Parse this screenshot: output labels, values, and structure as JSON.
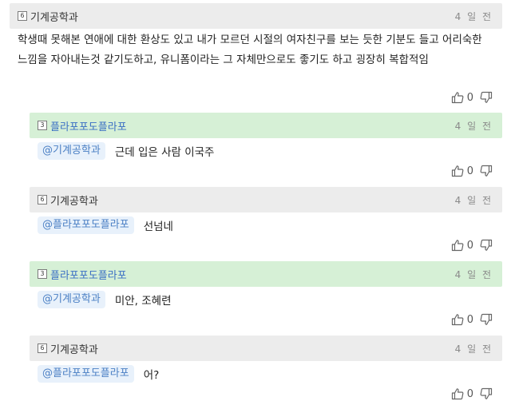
{
  "comments": [
    {
      "author": "기계공학과",
      "level": "6",
      "time": "4 일 전",
      "text": "학생때 못해본 연애에 대한 환상도 있고 내가 모르던 시절의 여자친구를 보는 듯한 기분도 들고 어리숙한 느낌을 자아내는것 같기도하고, 유니폼이라는 그 자체만으로도 좋기도 하고 굉장히 복합적임",
      "likes": "0"
    },
    {
      "author": "플라포포도플라포",
      "level": "3",
      "time": "4 일 전",
      "mention": "@기계공학과",
      "text": "근데 입은 사람 이국주",
      "likes": "0"
    },
    {
      "author": "기계공학과",
      "level": "6",
      "time": "4 일 전",
      "mention": "@플라포포도플라포",
      "text": "선넘네",
      "likes": "0"
    },
    {
      "author": "플라포포도플라포",
      "level": "3",
      "time": "4 일 전",
      "mention": "@기계공학과",
      "text": "미안, 조혜련",
      "likes": "0"
    },
    {
      "author": "기계공학과",
      "level": "6",
      "time": "4 일 전",
      "mention": "@플라포포도플라포",
      "text": "어?",
      "likes": "0"
    }
  ],
  "icons": {
    "like": "thumbs-up-icon",
    "dislike": "thumbs-down-icon",
    "level": "level-badge-icon"
  },
  "colors": {
    "header_gray": "#ececec",
    "header_green": "#d6f0d6",
    "mention_bg": "#e8f1fb",
    "mention_text": "#4a7fc4"
  }
}
